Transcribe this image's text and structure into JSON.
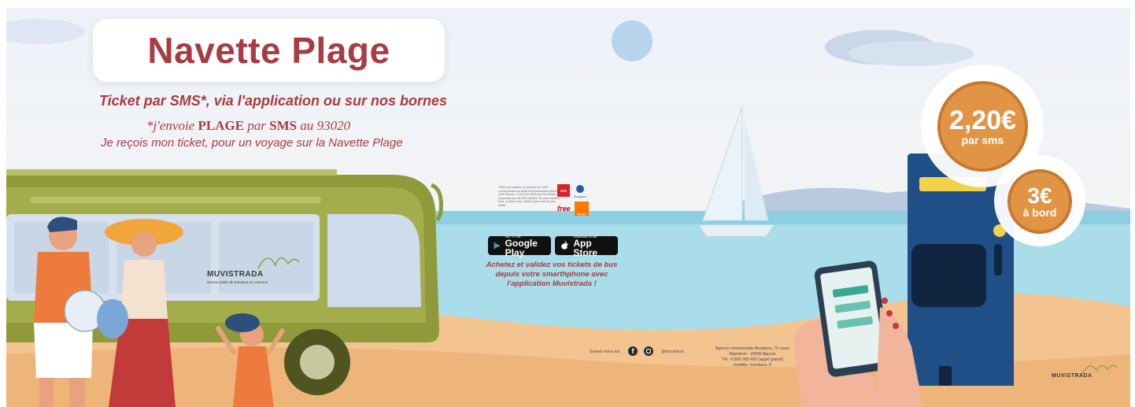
{
  "banner": {
    "title": "Navette Plage",
    "subtitle": "Ticket par SMS*, via l'application ou sur nos bornes",
    "sms_line": {
      "prefix": "*j'envoie",
      "keyword": "PLAGE",
      "middle": "par",
      "sms_word": "SMS",
      "suffix": "au 93020"
    },
    "receipt_line": "Je reçois mon ticket, pour un voyage sur la Navette Plage"
  },
  "bus": {
    "brand": "MUVISTRADA",
    "tagline": "service public de transport en commun"
  },
  "fine_print": "*SMS non surtaxé, le montant de 2,20€ correspondant au ticket est directement prélevé sur votre facture. • Coût d'un SMS pour les forfaits ne proposant pas les SMS illimités. En cas d'achat à bord, le ticket reste valable après arrêt du bus utilisé.",
  "operators": [
    "SFR",
    "Bouygues",
    "free",
    "orange"
  ],
  "stores": {
    "google_small": "GET IT ON",
    "google_name": "Google Play",
    "apple_small": "Download on the",
    "apple_name": "App Store"
  },
  "app_promo": "Achetez et validez vos tickets de bus depuis votre smarthphone avec l'application Muvistrada !",
  "social": {
    "follow": "Suivez nous sur",
    "handle": "@muvitarra",
    "icons": [
      "facebook-icon",
      "instagram-icon"
    ]
  },
  "agency": {
    "line1": "Agence commerciale Muvitarra, 75 cours",
    "line2": "Napoléon - 20000 Ajaccio",
    "line3": "Tél : 0 800 000 400 (appel gratuit)",
    "line4": "mobilite. muvitarra. fr"
  },
  "prices": {
    "sms_price": "2,20€",
    "sms_label": "par sms",
    "board_price": "3€",
    "board_label": "à bord"
  },
  "footer_brand": "MUVISTRADA",
  "colors": {
    "brand_red": "#a83c42",
    "bus_green": "#8f9a3a",
    "coin_orange": "#e19544",
    "kiosk_blue": "#1f4f86",
    "sea": "#a9dde9",
    "sand": "#f3c490"
  }
}
